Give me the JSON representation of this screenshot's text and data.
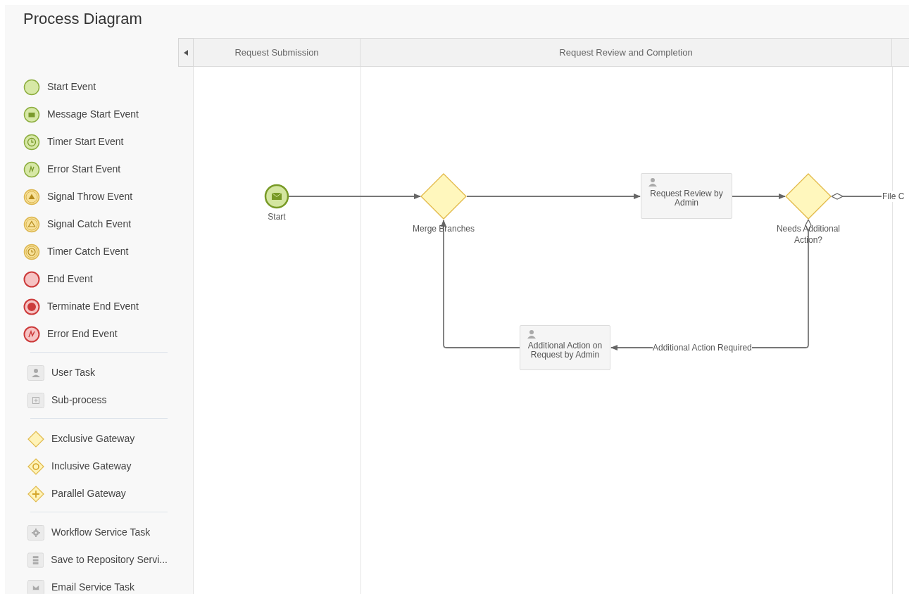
{
  "title": "Process Diagram",
  "palette": {
    "groups": [
      [
        {
          "kind": "start",
          "label": "Start Event"
        },
        {
          "kind": "message_start",
          "label": "Message Start Event"
        },
        {
          "kind": "timer_start",
          "label": "Timer Start Event"
        },
        {
          "kind": "error_start",
          "label": "Error Start Event"
        },
        {
          "kind": "signal_throw",
          "label": "Signal Throw Event"
        },
        {
          "kind": "signal_catch",
          "label": "Signal Catch Event"
        },
        {
          "kind": "timer_catch",
          "label": "Timer Catch Event"
        },
        {
          "kind": "end",
          "label": "End Event"
        },
        {
          "kind": "terminate_end",
          "label": "Terminate End Event"
        },
        {
          "kind": "error_end",
          "label": "Error End Event"
        }
      ],
      [
        {
          "kind": "user_task",
          "label": "User Task"
        },
        {
          "kind": "subprocess",
          "label": "Sub-process"
        }
      ],
      [
        {
          "kind": "exclusive_gateway",
          "label": "Exclusive Gateway"
        },
        {
          "kind": "inclusive_gateway",
          "label": "Inclusive Gateway"
        },
        {
          "kind": "parallel_gateway",
          "label": "Parallel Gateway"
        }
      ],
      [
        {
          "kind": "workflow_service",
          "label": "Workflow Service Task"
        },
        {
          "kind": "repository_service",
          "label": "Save to Repository Servi..."
        },
        {
          "kind": "email_service",
          "label": "Email Service Task"
        }
      ]
    ]
  },
  "lanes": [
    {
      "label": "Request Submission"
    },
    {
      "label": "Request Review and Completion"
    }
  ],
  "diagram": {
    "nodes": [
      {
        "kind": "message_start",
        "label": "Start"
      },
      {
        "kind": "gateway",
        "label": "Merge Branches"
      },
      {
        "kind": "user_task",
        "label": "Request Review by Admin"
      },
      {
        "kind": "gateway",
        "label": "Needs Additional Action?"
      },
      {
        "kind": "user_task",
        "label": "Additional Action on Request by Admin"
      }
    ],
    "flow_labels": [
      "File C",
      "Additional Action Required"
    ]
  }
}
